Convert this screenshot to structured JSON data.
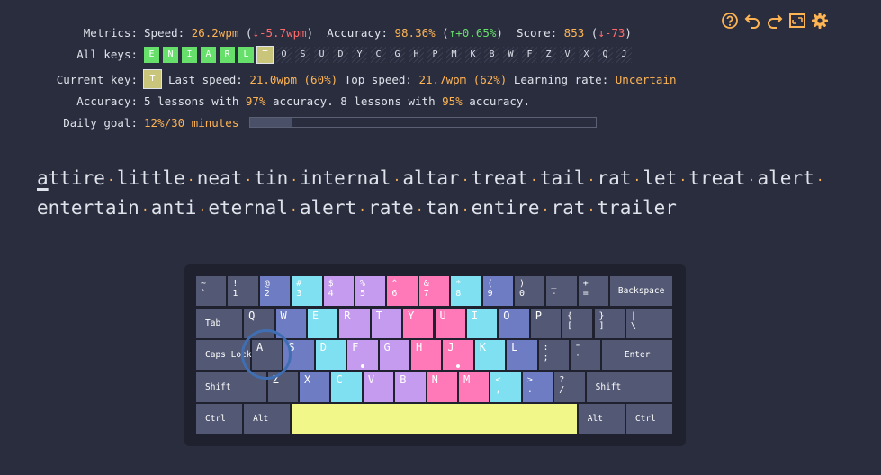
{
  "toolbar": {
    "help_icon": "help-icon",
    "undo_icon": "undo-icon",
    "redo_icon": "redo-icon",
    "fullscreen_icon": "fullscreen-icon",
    "settings_icon": "gear-icon"
  },
  "metrics": {
    "label": "Metrics:",
    "speed_label": "Speed:",
    "speed_value": "26.2wpm",
    "speed_delta": "↓-5.7wpm",
    "accuracy_label": "Accuracy:",
    "accuracy_value": "98.36%",
    "accuracy_delta": "↑+0.65%",
    "score_label": "Score:",
    "score_value": "853",
    "score_delta": "↓-73"
  },
  "all_keys": {
    "label": "All keys:",
    "keys": [
      {
        "k": "E",
        "s": "b"
      },
      {
        "k": "N",
        "s": "b"
      },
      {
        "k": "I",
        "s": "b"
      },
      {
        "k": "A",
        "s": "b"
      },
      {
        "k": "R",
        "s": "b"
      },
      {
        "k": "L",
        "s": "b"
      },
      {
        "k": "T",
        "s": "cur"
      },
      {
        "k": "O",
        "s": "l"
      },
      {
        "k": "S",
        "s": "l"
      },
      {
        "k": "U",
        "s": "l"
      },
      {
        "k": "D",
        "s": "l"
      },
      {
        "k": "Y",
        "s": "l"
      },
      {
        "k": "C",
        "s": "l"
      },
      {
        "k": "G",
        "s": "l"
      },
      {
        "k": "H",
        "s": "l"
      },
      {
        "k": "P",
        "s": "l"
      },
      {
        "k": "M",
        "s": "l"
      },
      {
        "k": "K",
        "s": "l"
      },
      {
        "k": "B",
        "s": "l"
      },
      {
        "k": "W",
        "s": "l"
      },
      {
        "k": "F",
        "s": "l"
      },
      {
        "k": "Z",
        "s": "l"
      },
      {
        "k": "V",
        "s": "l"
      },
      {
        "k": "X",
        "s": "l"
      },
      {
        "k": "Q",
        "s": "l"
      },
      {
        "k": "J",
        "s": "l"
      }
    ]
  },
  "current_key": {
    "label": "Current key:",
    "key": "T",
    "last_speed_label": "Last speed:",
    "last_speed_value": "21.0wpm (60%)",
    "top_speed_label": "Top speed:",
    "top_speed_value": "21.7wpm (62%)",
    "learning_rate_label": "Learning rate:",
    "learning_rate_value": "Uncertain"
  },
  "accuracy": {
    "label": "Accuracy:",
    "t1": "5 lessons with ",
    "v1": "97%",
    "t2": " accuracy. 8 lessons with ",
    "v2": "95%",
    "t3": " accuracy."
  },
  "daily_goal": {
    "label": "Daily goal:",
    "value": "12%/30 minutes",
    "progress": 0.12
  },
  "lesson_text": {
    "line1": [
      "attire",
      "little",
      "neat",
      "tin",
      "internal",
      "altar",
      "treat",
      "tail",
      "rat",
      "let",
      "treat",
      "alert",
      ""
    ],
    "line2": [
      "entertain",
      "anti",
      "eternal",
      "alert",
      "rate",
      "tan",
      "entire",
      "rat",
      "trailer"
    ],
    "space_glyph": "·"
  },
  "keyboard": {
    "colors": {
      "grey": "#535974",
      "blue": "#6e7cc4",
      "cyan": "#7ee0f0",
      "purple": "#c59bf0",
      "pink": "#ff79b8",
      "space": "#f2f78a"
    },
    "rows": [
      [
        [
          "~\n`",
          "grey",
          1
        ],
        [
          "!\n1",
          "grey",
          1
        ],
        [
          "@\n2",
          "blue",
          1
        ],
        [
          "#\n3",
          "cyan",
          1
        ],
        [
          "$\n4",
          "purple",
          1
        ],
        [
          "%\n5",
          "purple",
          1
        ],
        [
          "^\n6",
          "pink",
          1
        ],
        [
          "&\n7",
          "pink",
          1
        ],
        [
          "*\n8",
          "cyan",
          1
        ],
        [
          "(\n9",
          "blue",
          1
        ],
        [
          ")\n0",
          "grey",
          1
        ],
        [
          "_\n-",
          "grey",
          1
        ],
        [
          "+\n=",
          "grey",
          1
        ],
        [
          "Backspace",
          "grey",
          2
        ]
      ],
      [
        [
          "Tab",
          "grey",
          1.5
        ],
        [
          "Q",
          "grey",
          1
        ],
        [
          "W",
          "blue",
          1
        ],
        [
          "E",
          "cyan",
          1
        ],
        [
          "R",
          "purple",
          1
        ],
        [
          "T",
          "purple",
          1
        ],
        [
          "Y",
          "pink",
          1
        ],
        [
          "U",
          "pink",
          1
        ],
        [
          "I",
          "cyan",
          1
        ],
        [
          "O",
          "blue",
          1
        ],
        [
          "P",
          "grey",
          1
        ],
        [
          "{\n[",
          "grey",
          1
        ],
        [
          "}\n]",
          "grey",
          1
        ],
        [
          "|\n\\",
          "grey",
          1.5
        ]
      ],
      [
        [
          "Caps Lock",
          "grey",
          1.75
        ],
        [
          "A",
          "grey",
          1
        ],
        [
          "S",
          "blue",
          1
        ],
        [
          "D",
          "cyan",
          1
        ],
        [
          "F",
          "purple",
          1
        ],
        [
          "G",
          "purple",
          1
        ],
        [
          "H",
          "pink",
          1
        ],
        [
          "J",
          "pink",
          1
        ],
        [
          "K",
          "cyan",
          1
        ],
        [
          "L",
          "blue",
          1
        ],
        [
          ":\n;",
          "grey",
          1
        ],
        [
          "\"\n'",
          "grey",
          1
        ],
        [
          "Enter",
          "grey",
          2.25
        ]
      ],
      [
        [
          "Shift",
          "grey",
          2.25
        ],
        [
          "Z",
          "grey",
          1
        ],
        [
          "X",
          "blue",
          1
        ],
        [
          "C",
          "cyan",
          1
        ],
        [
          "V",
          "purple",
          1
        ],
        [
          "B",
          "purple",
          1
        ],
        [
          "N",
          "pink",
          1
        ],
        [
          "M",
          "pink",
          1
        ],
        [
          "<\n,",
          "cyan",
          1
        ],
        [
          ">\n.",
          "blue",
          1
        ],
        [
          "?\n/",
          "grey",
          1
        ],
        [
          "Shift",
          "grey",
          2.75
        ]
      ],
      [
        [
          "Ctrl",
          "grey",
          1.5
        ],
        [
          "Alt",
          "grey",
          1.5
        ],
        [
          "",
          "space",
          9
        ],
        [
          "Alt",
          "grey",
          1.5
        ],
        [
          "Ctrl",
          "grey",
          1.5
        ]
      ]
    ],
    "home_dots": [
      "F",
      "J"
    ],
    "current_finger_key": "A"
  }
}
